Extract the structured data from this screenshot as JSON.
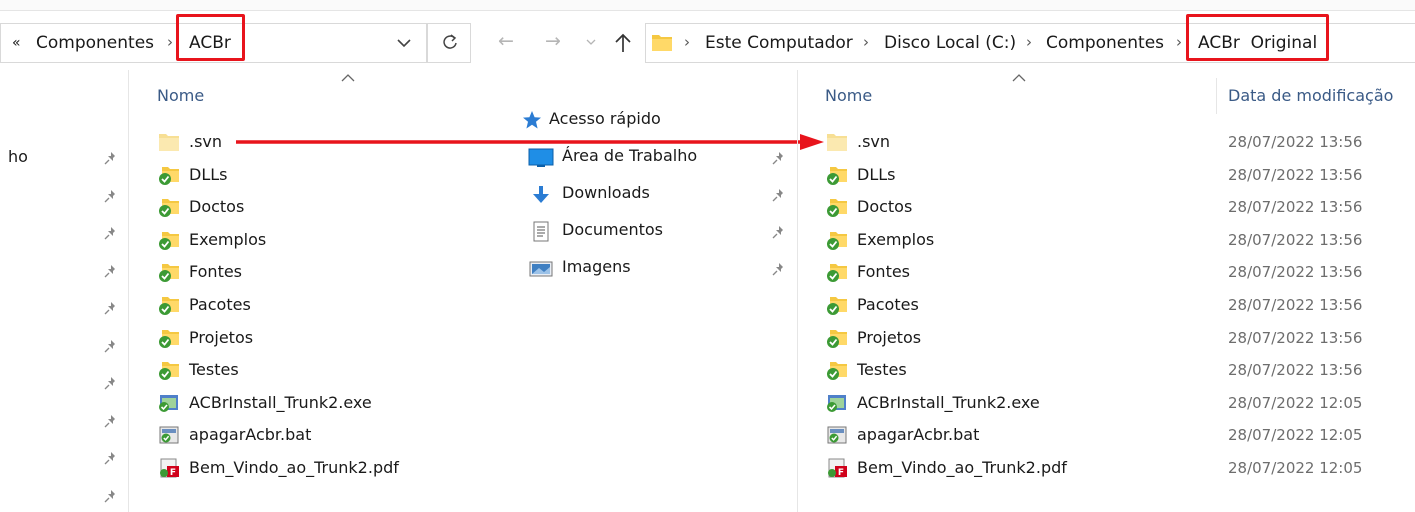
{
  "left_window": {
    "breadcrumb": {
      "overflow": "«",
      "items": [
        "Componentes",
        "ACBr"
      ]
    },
    "column_header": "Nome",
    "sidebar_partial": "ho",
    "files": [
      {
        "name": ".svn",
        "type": "folder-plain"
      },
      {
        "name": "DLLs",
        "type": "folder-synced"
      },
      {
        "name": "Doctos",
        "type": "folder-synced"
      },
      {
        "name": "Exemplos",
        "type": "folder-synced"
      },
      {
        "name": "Fontes",
        "type": "folder-synced"
      },
      {
        "name": "Pacotes",
        "type": "folder-synced"
      },
      {
        "name": "Projetos",
        "type": "folder-synced"
      },
      {
        "name": "Testes",
        "type": "folder-synced"
      },
      {
        "name": "ACBrInstall_Trunk2.exe",
        "type": "exe"
      },
      {
        "name": "apagarAcbr.bat",
        "type": "bat"
      },
      {
        "name": "Bem_Vindo_ao_Trunk2.pdf",
        "type": "pdf"
      }
    ]
  },
  "quick_access": {
    "header": "Acesso rápido",
    "items": [
      {
        "label": "Área de Trabalho",
        "icon": "desktop-icon"
      },
      {
        "label": "Downloads",
        "icon": "downloads-icon"
      },
      {
        "label": "Documentos",
        "icon": "documents-icon"
      },
      {
        "label": "Imagens",
        "icon": "images-icon"
      }
    ]
  },
  "right_window": {
    "breadcrumb": {
      "items": [
        "Este Computador",
        "Disco Local (C:)",
        "Componentes",
        "ACBr  Original"
      ]
    },
    "columns": {
      "name": "Nome",
      "date": "Data de modificação"
    },
    "files": [
      {
        "name": ".svn",
        "date": "28/07/2022 13:56",
        "type": "folder-plain"
      },
      {
        "name": "DLLs",
        "date": "28/07/2022 13:56",
        "type": "folder-synced"
      },
      {
        "name": "Doctos",
        "date": "28/07/2022 13:56",
        "type": "folder-synced"
      },
      {
        "name": "Exemplos",
        "date": "28/07/2022 13:56",
        "type": "folder-synced"
      },
      {
        "name": "Fontes",
        "date": "28/07/2022 13:56",
        "type": "folder-synced"
      },
      {
        "name": "Pacotes",
        "date": "28/07/2022 13:56",
        "type": "folder-synced"
      },
      {
        "name": "Projetos",
        "date": "28/07/2022 13:56",
        "type": "folder-synced"
      },
      {
        "name": "Testes",
        "date": "28/07/2022 13:56",
        "type": "folder-synced"
      },
      {
        "name": "ACBrInstall_Trunk2.exe",
        "date": "28/07/2022 12:05",
        "type": "exe"
      },
      {
        "name": "apagarAcbr.bat",
        "date": "28/07/2022 12:05",
        "type": "bat"
      },
      {
        "name": "Bem_Vindo_ao_Trunk2.pdf",
        "date": "28/07/2022 12:05",
        "type": "pdf"
      }
    ]
  },
  "colors": {
    "annotation_red": "#e8141c",
    "folder_yellow": "#f5c842",
    "sync_green": "#3c9a35",
    "header_blue": "#3a5a86"
  }
}
